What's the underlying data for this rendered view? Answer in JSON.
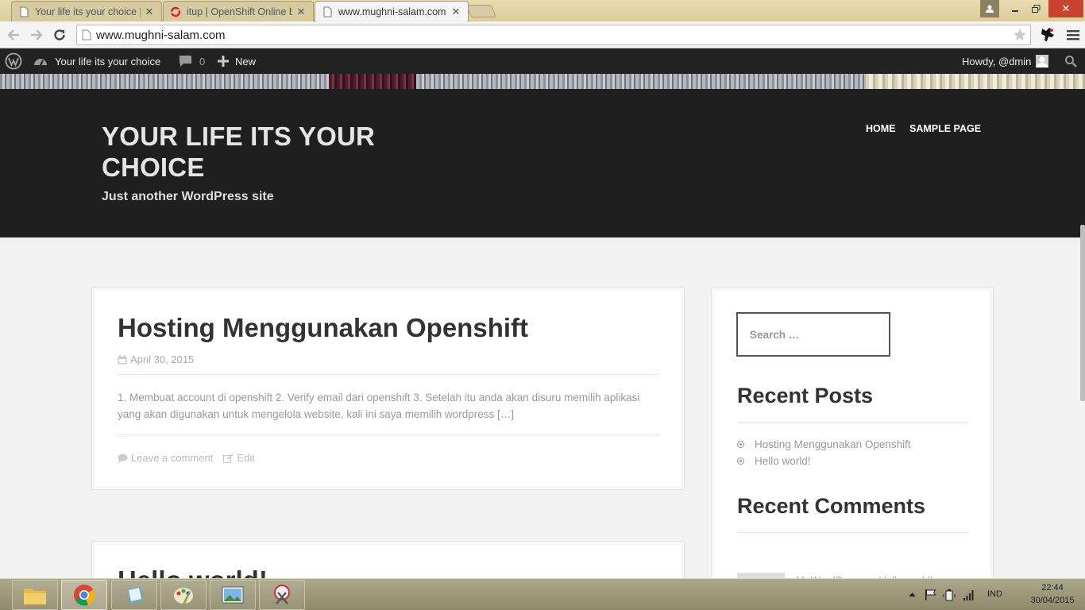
{
  "browser": {
    "tabs": [
      {
        "label": "Your life its your choice | J",
        "icon": "page-icon"
      },
      {
        "label": "itup | OpenShift Online by",
        "icon": "openshift-icon"
      },
      {
        "label": "www.mughni-salam.com",
        "icon": "page-icon",
        "active": true
      }
    ],
    "url": "www.mughni-salam.com"
  },
  "adminbar": {
    "site_name": "Your life its your choice",
    "comment_count": "0",
    "new_label": "New",
    "howdy": "Howdy, @dmin"
  },
  "site": {
    "title": "YOUR LIFE ITS YOUR CHOICE",
    "description": "Just another WordPress site",
    "nav": [
      "HOME",
      "SAMPLE PAGE"
    ]
  },
  "posts": [
    {
      "title": "Hosting Menggunakan Openshift",
      "date": "April 30, 2015",
      "excerpt": "1. Membuat account di openshift 2. Verify email dari openshift   3. Setelah itu anda akan disuru memilih aplikasi yang akan digunakan untuk mengelola website, kali ini saya memilih wordpress […]",
      "comment_link": "Leave a comment",
      "edit_link": "Edit"
    },
    {
      "title": "Hello world!"
    }
  ],
  "sidebar": {
    "search_placeholder": "Search …",
    "recent_posts_title": "Recent Posts",
    "recent_posts": [
      "Hosting Menggunakan Openshift",
      "Hello world!"
    ],
    "recent_comments_title": "Recent Comments",
    "recent_comment_text": "Mr WordPress on Hello world!"
  },
  "taskbar": {
    "apps": [
      "file-explorer-icon",
      "chrome-icon",
      "notebook-icon",
      "paint-icon",
      "photo-viewer-icon",
      "snipping-tool-icon"
    ],
    "language": "IND",
    "time": "22:44",
    "date": "30/04/2015"
  },
  "colors": {
    "admin_bar": "#222222",
    "masthead": "#1f1f1f",
    "page_bg": "#f2f2f2",
    "taskbar": "#9e9b7d"
  }
}
